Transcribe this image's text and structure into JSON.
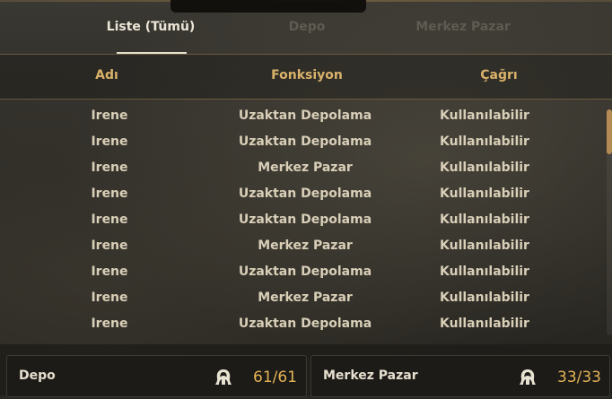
{
  "tooltip": "",
  "tabs": [
    {
      "label": "Liste (Tümü)",
      "active": true
    },
    {
      "label": "Depo",
      "active": false
    },
    {
      "label": "Merkez Pazar",
      "active": false
    }
  ],
  "columns": {
    "name": "Adı",
    "function": "Fonksiyon",
    "call": "Çağrı"
  },
  "rows": [
    {
      "name": "Irene",
      "function": "Uzaktan Depolama",
      "call": "Kullanılabilir"
    },
    {
      "name": "Irene",
      "function": "Uzaktan Depolama",
      "call": "Kullanılabilir"
    },
    {
      "name": "Irene",
      "function": "Merkez Pazar",
      "call": "Kullanılabilir"
    },
    {
      "name": "Irene",
      "function": "Uzaktan Depolama",
      "call": "Kullanılabilir"
    },
    {
      "name": "Irene",
      "function": "Uzaktan Depolama",
      "call": "Kullanılabilir"
    },
    {
      "name": "Irene",
      "function": "Merkez Pazar",
      "call": "Kullanılabilir"
    },
    {
      "name": "Irene",
      "function": "Uzaktan Depolama",
      "call": "Kullanılabilir"
    },
    {
      "name": "Irene",
      "function": "Merkez Pazar",
      "call": "Kullanılabilir"
    },
    {
      "name": "Irene",
      "function": "Uzaktan Depolama",
      "call": "Kullanılabilir"
    }
  ],
  "panels": {
    "depot": {
      "label": "Depo",
      "count": "61/61",
      "icon": "pet-maid-icon"
    },
    "market": {
      "label": "Merkez Pazar",
      "count": "33/33",
      "icon": "pet-maid-icon"
    }
  },
  "colors": {
    "accent": "#dab26a",
    "count": "#e3b355",
    "text": "#d9cfb8"
  }
}
